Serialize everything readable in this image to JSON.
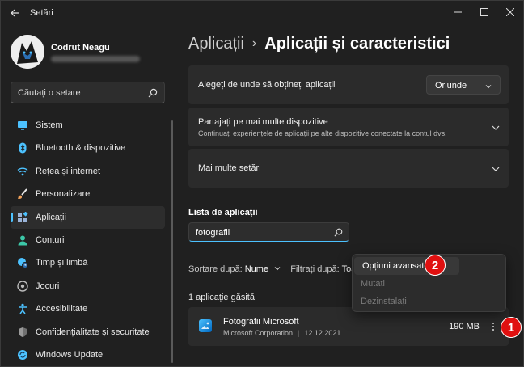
{
  "window": {
    "title": "Setări",
    "controls": [
      "minimize",
      "maximize",
      "close"
    ]
  },
  "profile": {
    "name": "Codrut Neagu"
  },
  "search": {
    "placeholder": "Căutați o setare"
  },
  "nav": {
    "items": [
      {
        "label": "Sistem",
        "icon": "monitor-icon",
        "color": "#4cc2ff"
      },
      {
        "label": "Bluetooth & dispozitive",
        "icon": "bluetooth-icon",
        "color": "#4cc2ff"
      },
      {
        "label": "Rețea și internet",
        "icon": "wifi-icon",
        "color": "#4cc2ff"
      },
      {
        "label": "Personalizare",
        "icon": "brush-icon",
        "color": "#f3a35b"
      },
      {
        "label": "Aplicații",
        "icon": "apps-icon",
        "color": "#9ab4d8",
        "active": true
      },
      {
        "label": "Conturi",
        "icon": "person-icon",
        "color": "#3cc8a8"
      },
      {
        "label": "Timp și limbă",
        "icon": "globe-clock-icon",
        "color": "#4cc2ff"
      },
      {
        "label": "Jocuri",
        "icon": "gamepad-icon",
        "color": "#bbbbbb"
      },
      {
        "label": "Accesibilitate",
        "icon": "accessibility-icon",
        "color": "#4cc2ff"
      },
      {
        "label": "Confidențialitate și securitate",
        "icon": "shield-icon",
        "color": "#9a9a9a"
      },
      {
        "label": "Windows Update",
        "icon": "update-icon",
        "color": "#4cc2ff"
      }
    ]
  },
  "breadcrumb": {
    "parent": "Aplicații",
    "separator": "›",
    "current": "Aplicații și caracteristici"
  },
  "cards": {
    "source": {
      "title": "Alegeți de unde să obțineți aplicații",
      "dropdown_value": "Oriunde"
    },
    "share": {
      "title": "Partajați pe mai multe dispozitive",
      "subtitle": "Continuați experiențele de aplicații pe alte dispozitive conectate la contul dvs."
    },
    "more": {
      "title": "Mai multe setări"
    }
  },
  "app_list": {
    "title": "Lista de aplicații",
    "search_value": "fotografii",
    "sort_label": "Sortare după:",
    "sort_value": "Nume",
    "filter_label": "Filtrați după:",
    "filter_value": "Toate",
    "found": "1 aplicație găsită",
    "apps": [
      {
        "name": "Fotografii Microsoft",
        "publisher": "Microsoft Corporation",
        "date": "12.12.2021",
        "size": "190 MB"
      }
    ]
  },
  "context_menu": {
    "items": [
      {
        "label": "Opțiuni avansate",
        "enabled": true
      },
      {
        "label": "Mutați",
        "enabled": false
      },
      {
        "label": "Dezinstalați",
        "enabled": false
      }
    ]
  },
  "markers": [
    "1",
    "2"
  ],
  "colors": {
    "accent": "#4cc2ff",
    "background": "#202020",
    "card": "#2b2b2b",
    "marker": "#e01010"
  }
}
